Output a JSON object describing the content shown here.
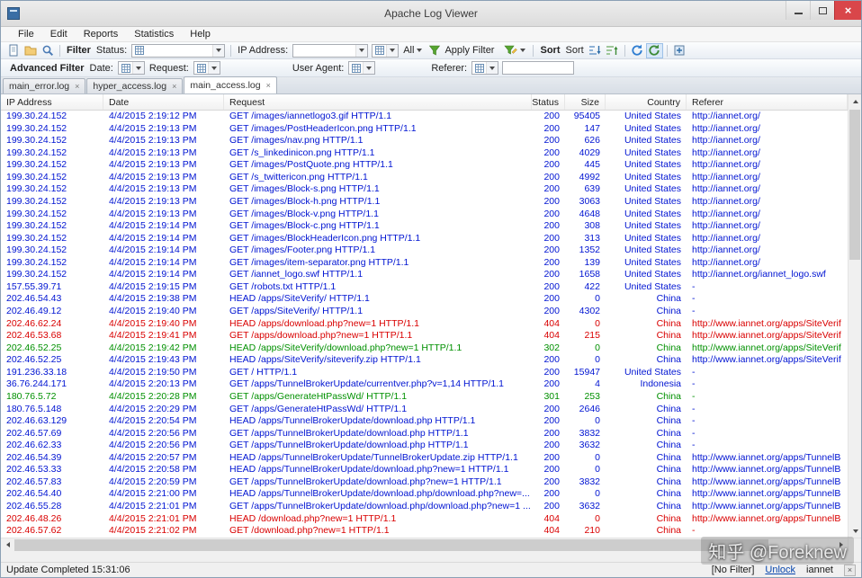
{
  "window": {
    "title": "Apache Log Viewer"
  },
  "menu": {
    "items": [
      "File",
      "Edit",
      "Reports",
      "Statistics",
      "Help"
    ]
  },
  "toolbar": {
    "filter_label": "Filter",
    "status_label": "Status:",
    "ip_label": "IP Address:",
    "all_label": "All",
    "apply_filter_label": "Apply Filter",
    "sort_label": "Sort",
    "sort_value": "Sort"
  },
  "advanced": {
    "label": "Advanced Filter",
    "date_label": "Date:",
    "request_label": "Request:",
    "user_agent_label": "User Agent:",
    "referer_label": "Referer:"
  },
  "tabs": [
    {
      "label": "main_error.log"
    },
    {
      "label": "hyper_access.log"
    },
    {
      "label": "main_access.log"
    }
  ],
  "table": {
    "columns": [
      "IP Address",
      "Date",
      "Request",
      "Status",
      "Size",
      "Country",
      "Referer"
    ],
    "rows": [
      {
        "ip": "199.30.24.152",
        "date": "4/4/2015 2:19:12 PM",
        "request": "GET /images/iannetlogo3.gif HTTP/1.1",
        "status": "200",
        "size": "95405",
        "country": "United States",
        "referer": "http://iannet.org/",
        "c": "b"
      },
      {
        "ip": "199.30.24.152",
        "date": "4/4/2015 2:19:13 PM",
        "request": "GET /images/PostHeaderIcon.png HTTP/1.1",
        "status": "200",
        "size": "147",
        "country": "United States",
        "referer": "http://iannet.org/",
        "c": "b"
      },
      {
        "ip": "199.30.24.152",
        "date": "4/4/2015 2:19:13 PM",
        "request": "GET /images/nav.png HTTP/1.1",
        "status": "200",
        "size": "626",
        "country": "United States",
        "referer": "http://iannet.org/",
        "c": "b"
      },
      {
        "ip": "199.30.24.152",
        "date": "4/4/2015 2:19:13 PM",
        "request": "GET /s_linkedinicon.png HTTP/1.1",
        "status": "200",
        "size": "4029",
        "country": "United States",
        "referer": "http://iannet.org/",
        "c": "b"
      },
      {
        "ip": "199.30.24.152",
        "date": "4/4/2015 2:19:13 PM",
        "request": "GET /images/PostQuote.png HTTP/1.1",
        "status": "200",
        "size": "445",
        "country": "United States",
        "referer": "http://iannet.org/",
        "c": "b"
      },
      {
        "ip": "199.30.24.152",
        "date": "4/4/2015 2:19:13 PM",
        "request": "GET /s_twittericon.png HTTP/1.1",
        "status": "200",
        "size": "4992",
        "country": "United States",
        "referer": "http://iannet.org/",
        "c": "b"
      },
      {
        "ip": "199.30.24.152",
        "date": "4/4/2015 2:19:13 PM",
        "request": "GET /images/Block-s.png HTTP/1.1",
        "status": "200",
        "size": "639",
        "country": "United States",
        "referer": "http://iannet.org/",
        "c": "b"
      },
      {
        "ip": "199.30.24.152",
        "date": "4/4/2015 2:19:13 PM",
        "request": "GET /images/Block-h.png HTTP/1.1",
        "status": "200",
        "size": "3063",
        "country": "United States",
        "referer": "http://iannet.org/",
        "c": "b"
      },
      {
        "ip": "199.30.24.152",
        "date": "4/4/2015 2:19:13 PM",
        "request": "GET /images/Block-v.png HTTP/1.1",
        "status": "200",
        "size": "4648",
        "country": "United States",
        "referer": "http://iannet.org/",
        "c": "b"
      },
      {
        "ip": "199.30.24.152",
        "date": "4/4/2015 2:19:14 PM",
        "request": "GET /images/Block-c.png HTTP/1.1",
        "status": "200",
        "size": "308",
        "country": "United States",
        "referer": "http://iannet.org/",
        "c": "b"
      },
      {
        "ip": "199.30.24.152",
        "date": "4/4/2015 2:19:14 PM",
        "request": "GET /images/BlockHeaderIcon.png HTTP/1.1",
        "status": "200",
        "size": "313",
        "country": "United States",
        "referer": "http://iannet.org/",
        "c": "b"
      },
      {
        "ip": "199.30.24.152",
        "date": "4/4/2015 2:19:14 PM",
        "request": "GET /images/Footer.png HTTP/1.1",
        "status": "200",
        "size": "1352",
        "country": "United States",
        "referer": "http://iannet.org/",
        "c": "b"
      },
      {
        "ip": "199.30.24.152",
        "date": "4/4/2015 2:19:14 PM",
        "request": "GET /images/item-separator.png HTTP/1.1",
        "status": "200",
        "size": "139",
        "country": "United States",
        "referer": "http://iannet.org/",
        "c": "b"
      },
      {
        "ip": "199.30.24.152",
        "date": "4/4/2015 2:19:14 PM",
        "request": "GET /iannet_logo.swf HTTP/1.1",
        "status": "200",
        "size": "1658",
        "country": "United States",
        "referer": "http://iannet.org/iannet_logo.swf",
        "c": "b"
      },
      {
        "ip": "157.55.39.71",
        "date": "4/4/2015 2:19:15 PM",
        "request": "GET /robots.txt HTTP/1.1",
        "status": "200",
        "size": "422",
        "country": "United States",
        "referer": "-",
        "c": "b"
      },
      {
        "ip": "202.46.54.43",
        "date": "4/4/2015 2:19:38 PM",
        "request": "HEAD /apps/SiteVerify/ HTTP/1.1",
        "status": "200",
        "size": "0",
        "country": "China",
        "referer": "-",
        "c": "b"
      },
      {
        "ip": "202.46.49.12",
        "date": "4/4/2015 2:19:40 PM",
        "request": "GET /apps/SiteVerify/ HTTP/1.1",
        "status": "200",
        "size": "4302",
        "country": "China",
        "referer": "-",
        "c": "b"
      },
      {
        "ip": "202.46.62.24",
        "date": "4/4/2015 2:19:40 PM",
        "request": "HEAD /apps/download.php?new=1 HTTP/1.1",
        "status": "404",
        "size": "0",
        "country": "China",
        "referer": "http://www.iannet.org/apps/SiteVerif",
        "c": "r"
      },
      {
        "ip": "202.46.53.68",
        "date": "4/4/2015 2:19:41 PM",
        "request": "GET /apps/download.php?new=1 HTTP/1.1",
        "status": "404",
        "size": "215",
        "country": "China",
        "referer": "http://www.iannet.org/apps/SiteVerif",
        "c": "r"
      },
      {
        "ip": "202.46.52.25",
        "date": "4/4/2015 2:19:42 PM",
        "request": "HEAD /apps/SiteVerify/download.php?new=1 HTTP/1.1",
        "status": "302",
        "size": "0",
        "country": "China",
        "referer": "http://www.iannet.org/apps/SiteVerif",
        "c": "g"
      },
      {
        "ip": "202.46.52.25",
        "date": "4/4/2015 2:19:43 PM",
        "request": "HEAD /apps/SiteVerify/siteverify.zip HTTP/1.1",
        "status": "200",
        "size": "0",
        "country": "China",
        "referer": "http://www.iannet.org/apps/SiteVerif",
        "c": "b"
      },
      {
        "ip": "191.236.33.18",
        "date": "4/4/2015 2:19:50 PM",
        "request": "GET / HTTP/1.1",
        "status": "200",
        "size": "15947",
        "country": "United States",
        "referer": "-",
        "c": "b"
      },
      {
        "ip": "36.76.244.171",
        "date": "4/4/2015 2:20:13 PM",
        "request": "GET /apps/TunnelBrokerUpdate/currentver.php?v=1,14 HTTP/1.1",
        "status": "200",
        "size": "4",
        "country": "Indonesia",
        "referer": "-",
        "c": "b"
      },
      {
        "ip": "180.76.5.72",
        "date": "4/4/2015 2:20:28 PM",
        "request": "GET /apps/GenerateHtPassWd/ HTTP/1.1",
        "status": "301",
        "size": "253",
        "country": "China",
        "referer": "-",
        "c": "g"
      },
      {
        "ip": "180.76.5.148",
        "date": "4/4/2015 2:20:29 PM",
        "request": "GET /apps/GenerateHtPassWd/ HTTP/1.1",
        "status": "200",
        "size": "2646",
        "country": "China",
        "referer": "-",
        "c": "b"
      },
      {
        "ip": "202.46.63.129",
        "date": "4/4/2015 2:20:54 PM",
        "request": "HEAD /apps/TunnelBrokerUpdate/download.php HTTP/1.1",
        "status": "200",
        "size": "0",
        "country": "China",
        "referer": "-",
        "c": "b"
      },
      {
        "ip": "202.46.57.69",
        "date": "4/4/2015 2:20:56 PM",
        "request": "GET /apps/TunnelBrokerUpdate/download.php HTTP/1.1",
        "status": "200",
        "size": "3832",
        "country": "China",
        "referer": "-",
        "c": "b"
      },
      {
        "ip": "202.46.62.33",
        "date": "4/4/2015 2:20:56 PM",
        "request": "GET /apps/TunnelBrokerUpdate/download.php HTTP/1.1",
        "status": "200",
        "size": "3632",
        "country": "China",
        "referer": "-",
        "c": "b"
      },
      {
        "ip": "202.46.54.39",
        "date": "4/4/2015 2:20:57 PM",
        "request": "HEAD /apps/TunnelBrokerUpdate/TunnelBrokerUpdate.zip HTTP/1.1",
        "status": "200",
        "size": "0",
        "country": "China",
        "referer": "http://www.iannet.org/apps/TunnelB",
        "c": "b"
      },
      {
        "ip": "202.46.53.33",
        "date": "4/4/2015 2:20:58 PM",
        "request": "HEAD /apps/TunnelBrokerUpdate/download.php?new=1 HTTP/1.1",
        "status": "200",
        "size": "0",
        "country": "China",
        "referer": "http://www.iannet.org/apps/TunnelB",
        "c": "b"
      },
      {
        "ip": "202.46.57.83",
        "date": "4/4/2015 2:20:59 PM",
        "request": "GET /apps/TunnelBrokerUpdate/download.php?new=1 HTTP/1.1",
        "status": "200",
        "size": "3832",
        "country": "China",
        "referer": "http://www.iannet.org/apps/TunnelB",
        "c": "b"
      },
      {
        "ip": "202.46.54.40",
        "date": "4/4/2015 2:21:00 PM",
        "request": "HEAD /apps/TunnelBrokerUpdate/download.php/download.php?new=...",
        "status": "200",
        "size": "0",
        "country": "China",
        "referer": "http://www.iannet.org/apps/TunnelB",
        "c": "b"
      },
      {
        "ip": "202.46.55.28",
        "date": "4/4/2015 2:21:01 PM",
        "request": "GET /apps/TunnelBrokerUpdate/download.php/download.php?new=1 ...",
        "status": "200",
        "size": "3632",
        "country": "China",
        "referer": "http://www.iannet.org/apps/TunnelB",
        "c": "b"
      },
      {
        "ip": "202.46.48.26",
        "date": "4/4/2015 2:21:01 PM",
        "request": "HEAD /download.php?new=1 HTTP/1.1",
        "status": "404",
        "size": "0",
        "country": "China",
        "referer": "http://www.iannet.org/apps/TunnelB",
        "c": "r"
      },
      {
        "ip": "202.46.57.62",
        "date": "4/4/2015 2:21:02 PM",
        "request": "GET /download.php?new=1 HTTP/1.1",
        "status": "404",
        "size": "210",
        "country": "China",
        "referer": "-",
        "c": "r"
      }
    ]
  },
  "statusbar": {
    "left": "Update Completed 15:31:06",
    "filter": "[No Filter]",
    "unlock": "Unlock",
    "user": "iannet"
  },
  "watermark": "知乎 @Foreknew",
  "colors": {
    "b": "#0014d2",
    "r": "#d90000",
    "g": "#009000"
  },
  "icons": {
    "open_file": "folder-shape",
    "open_document": "page-shape",
    "search": "magnifier-shape",
    "apply_filter": "green-funnel",
    "filter_edit": "funnel-pencil",
    "sort_asc": "bars-arrow-down",
    "sort_desc": "bars-arrow-up",
    "refresh": "circular-arrow"
  }
}
